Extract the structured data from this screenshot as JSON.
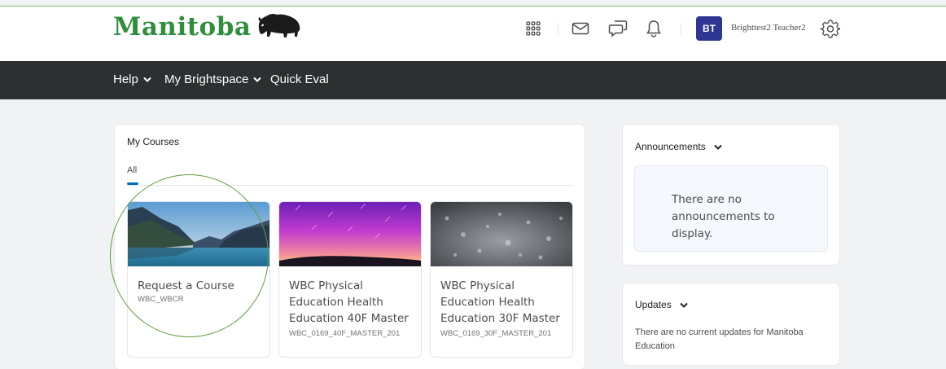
{
  "brand": {
    "name": "Manitoba"
  },
  "header": {
    "user_initials": "BT",
    "user_name": "Brighttest2 Teacher2",
    "icons": [
      "waffle-icon",
      "mail-icon",
      "chat-icon",
      "bell-icon",
      "gear-icon"
    ]
  },
  "nav": {
    "items": [
      {
        "label": "Help",
        "has_dropdown": true
      },
      {
        "label": "My Brightspace",
        "has_dropdown": true
      },
      {
        "label": "Quick Eval",
        "has_dropdown": false
      }
    ]
  },
  "my_courses": {
    "title": "My Courses",
    "tabs": [
      {
        "label": "All",
        "selected": true
      }
    ],
    "courses": [
      {
        "name": "Request a Course",
        "code": "WBC_WBCR",
        "image": "mountain-lake"
      },
      {
        "name": "WBC Physical Education Health Education 40F Master",
        "code": "WBC_0169_40F_MASTER_201",
        "image": "purple-sky"
      },
      {
        "name": "WBC Physical Education Health Education 30F Master",
        "code": "WBC_0169_30F_MASTER_201",
        "image": "water-droplets"
      }
    ]
  },
  "announcements": {
    "title": "Announcements",
    "message": "There are no announcements to display."
  },
  "updates": {
    "title": "Updates",
    "message": "There are no current updates for Manitoba Education"
  },
  "colors": {
    "brand_green": "#2f8f3c",
    "nav_bg": "#2d2f31",
    "avatar_bg": "#2e3592",
    "tab_accent": "#006fbf"
  }
}
